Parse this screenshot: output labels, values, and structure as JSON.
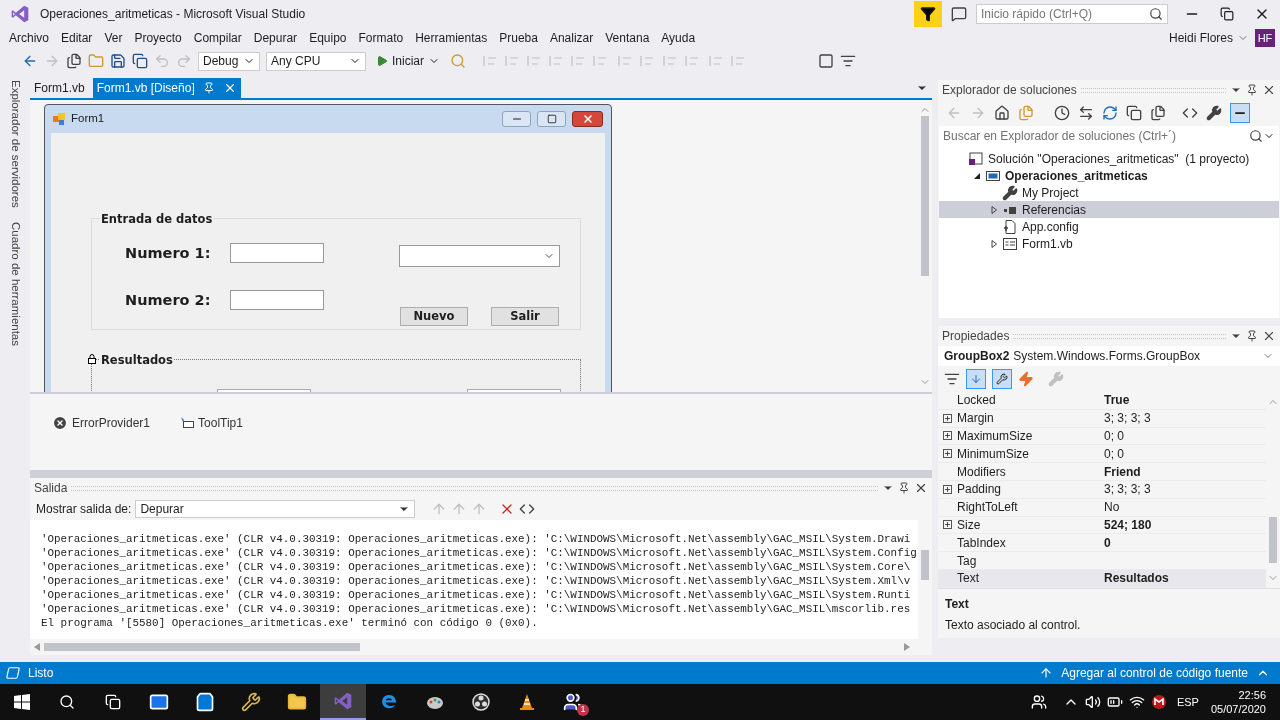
{
  "window": {
    "title": "Operaciones_aritmeticas - Microsoft Visual Studio",
    "quick_launch": {
      "placeholder": "Inicio rápido (Ctrl+Q)"
    },
    "user": {
      "name": "Heidi Flores",
      "initials": "HF"
    }
  },
  "menu": [
    "Archivo",
    "Editar",
    "Ver",
    "Proyecto",
    "Compilar",
    "Depurar",
    "Equipo",
    "Formato",
    "Herramientas",
    "Prueba",
    "Analizar",
    "Ventana",
    "Ayuda"
  ],
  "toolbar": {
    "configuration": "Debug",
    "platform": "Any CPU",
    "start": "Iniciar"
  },
  "side_tabs": [
    "Explorador de servidores",
    "Cuadro de herramientas"
  ],
  "document_tabs": [
    {
      "label": "Form1.vb",
      "selected": false
    },
    {
      "label": "Form1.vb [Diseño]",
      "selected": true
    }
  ],
  "form": {
    "title": "Form1",
    "groups": [
      {
        "title": "Entrada de datos",
        "selected": false
      },
      {
        "title": "Resultados",
        "selected": true
      }
    ],
    "fields": [
      {
        "label": "Numero 1:"
      },
      {
        "label": "Numero 2:"
      }
    ],
    "buttons": [
      "Nuevo",
      "Salir"
    ]
  },
  "components": [
    {
      "name": "ErrorProvider1",
      "kind": "error"
    },
    {
      "name": "ToolTip1",
      "kind": "tooltip"
    }
  ],
  "output": {
    "title": "Salida",
    "source_label": "Mostrar salida de:",
    "source": "Depurar",
    "lines": [
      "'Operaciones_aritmeticas.exe' (CLR v4.0.30319: Operaciones_aritmeticas.exe): 'C:\\WINDOWS\\Microsoft.Net\\assembly\\GAC_MSIL\\System.Drawi",
      "'Operaciones_aritmeticas.exe' (CLR v4.0.30319: Operaciones_aritmeticas.exe): 'C:\\WINDOWS\\Microsoft.Net\\assembly\\GAC_MSIL\\System.Config",
      "'Operaciones_aritmeticas.exe' (CLR v4.0.30319: Operaciones_aritmeticas.exe): 'C:\\WINDOWS\\Microsoft.Net\\assembly\\GAC_MSIL\\System.Core\\",
      "'Operaciones_aritmeticas.exe' (CLR v4.0.30319: Operaciones_aritmeticas.exe): 'C:\\WINDOWS\\Microsoft.Net\\assembly\\GAC_MSIL\\System.Xml\\v",
      "'Operaciones_aritmeticas.exe' (CLR v4.0.30319: Operaciones_aritmeticas.exe): 'C:\\WINDOWS\\Microsoft.Net\\assembly\\GAC_MSIL\\System.Runti",
      "'Operaciones_aritmeticas.exe' (CLR v4.0.30319: Operaciones_aritmeticas.exe): 'C:\\WINDOWS\\Microsoft.Net\\assembly\\GAC_MSIL\\mscorlib.res",
      "El programa '[5580] Operaciones_aritmeticas.exe' terminó con código 0 (0x0)."
    ]
  },
  "solution_explorer": {
    "title": "Explorador de soluciones",
    "search": {
      "placeholder": "Buscar en Explorador de soluciones (Ctrl+´)"
    },
    "tree": [
      {
        "label": "Solución \"Operaciones_aritmeticas\"  (1 proyecto)",
        "kind": "solution",
        "selected": false,
        "children": [
          {
            "label": "Operaciones_aritmeticas",
            "kind": "project",
            "selected": false,
            "expanded": true,
            "children": [
              {
                "label": "My Project",
                "kind": "wrench",
                "selected": false
              },
              {
                "label": "Referencias",
                "kind": "references",
                "selected": true,
                "expanded": false
              },
              {
                "label": "App.config",
                "kind": "config",
                "selected": false
              },
              {
                "label": "Form1.vb",
                "kind": "form",
                "selected": false,
                "expanded": false
              }
            ]
          }
        ]
      }
    ]
  },
  "properties": {
    "title": "Propiedades",
    "object": "GroupBox2",
    "type": "System.Windows.Forms.GroupBox",
    "rows": [
      {
        "name": "Locked",
        "value": "True",
        "modified": true,
        "expandable": false,
        "selected": false
      },
      {
        "name": "Margin",
        "value": "3; 3; 3; 3",
        "modified": false,
        "expandable": true,
        "selected": false
      },
      {
        "name": "MaximumSize",
        "value": "0; 0",
        "modified": false,
        "expandable": true,
        "selected": false
      },
      {
        "name": "MinimumSize",
        "value": "0; 0",
        "modified": false,
        "expandable": true,
        "selected": false
      },
      {
        "name": "Modifiers",
        "value": "Friend",
        "modified": true,
        "expandable": false,
        "selected": false
      },
      {
        "name": "Padding",
        "value": "3; 3; 3; 3",
        "modified": false,
        "expandable": true,
        "selected": false
      },
      {
        "name": "RightToLeft",
        "value": "No",
        "modified": false,
        "expandable": false,
        "selected": false
      },
      {
        "name": "Size",
        "value": "524; 180",
        "modified": true,
        "expandable": true,
        "selected": false
      },
      {
        "name": "TabIndex",
        "value": "0",
        "modified": true,
        "expandable": false,
        "selected": false
      },
      {
        "name": "Tag",
        "expandable": false,
        "selected": false
      },
      {
        "name": "Text",
        "value": "Resultados",
        "modified": true,
        "expandable": false,
        "selected": true
      }
    ],
    "description": {
      "title": "Text",
      "text": "Texto asociado al control."
    }
  },
  "status_bar": {
    "text": "Listo",
    "source_control": "Agregar al control de código fuente"
  },
  "taskbar": {
    "apps": [
      {
        "kind": "mail",
        "selected": false
      },
      {
        "kind": "store",
        "selected": false
      },
      {
        "kind": "tools",
        "selected": false
      },
      {
        "kind": "folder",
        "selected": false
      },
      {
        "kind": "visualstudio",
        "selected": true
      },
      {
        "kind": "edge",
        "selected": false
      },
      {
        "kind": "paint",
        "selected": false
      },
      {
        "kind": "obs",
        "selected": false
      },
      {
        "kind": "vlc",
        "selected": false
      },
      {
        "kind": "teams",
        "selected": false,
        "badge": "1"
      }
    ],
    "language": "ESP",
    "time": "22:56",
    "date": "05/07/2020"
  }
}
